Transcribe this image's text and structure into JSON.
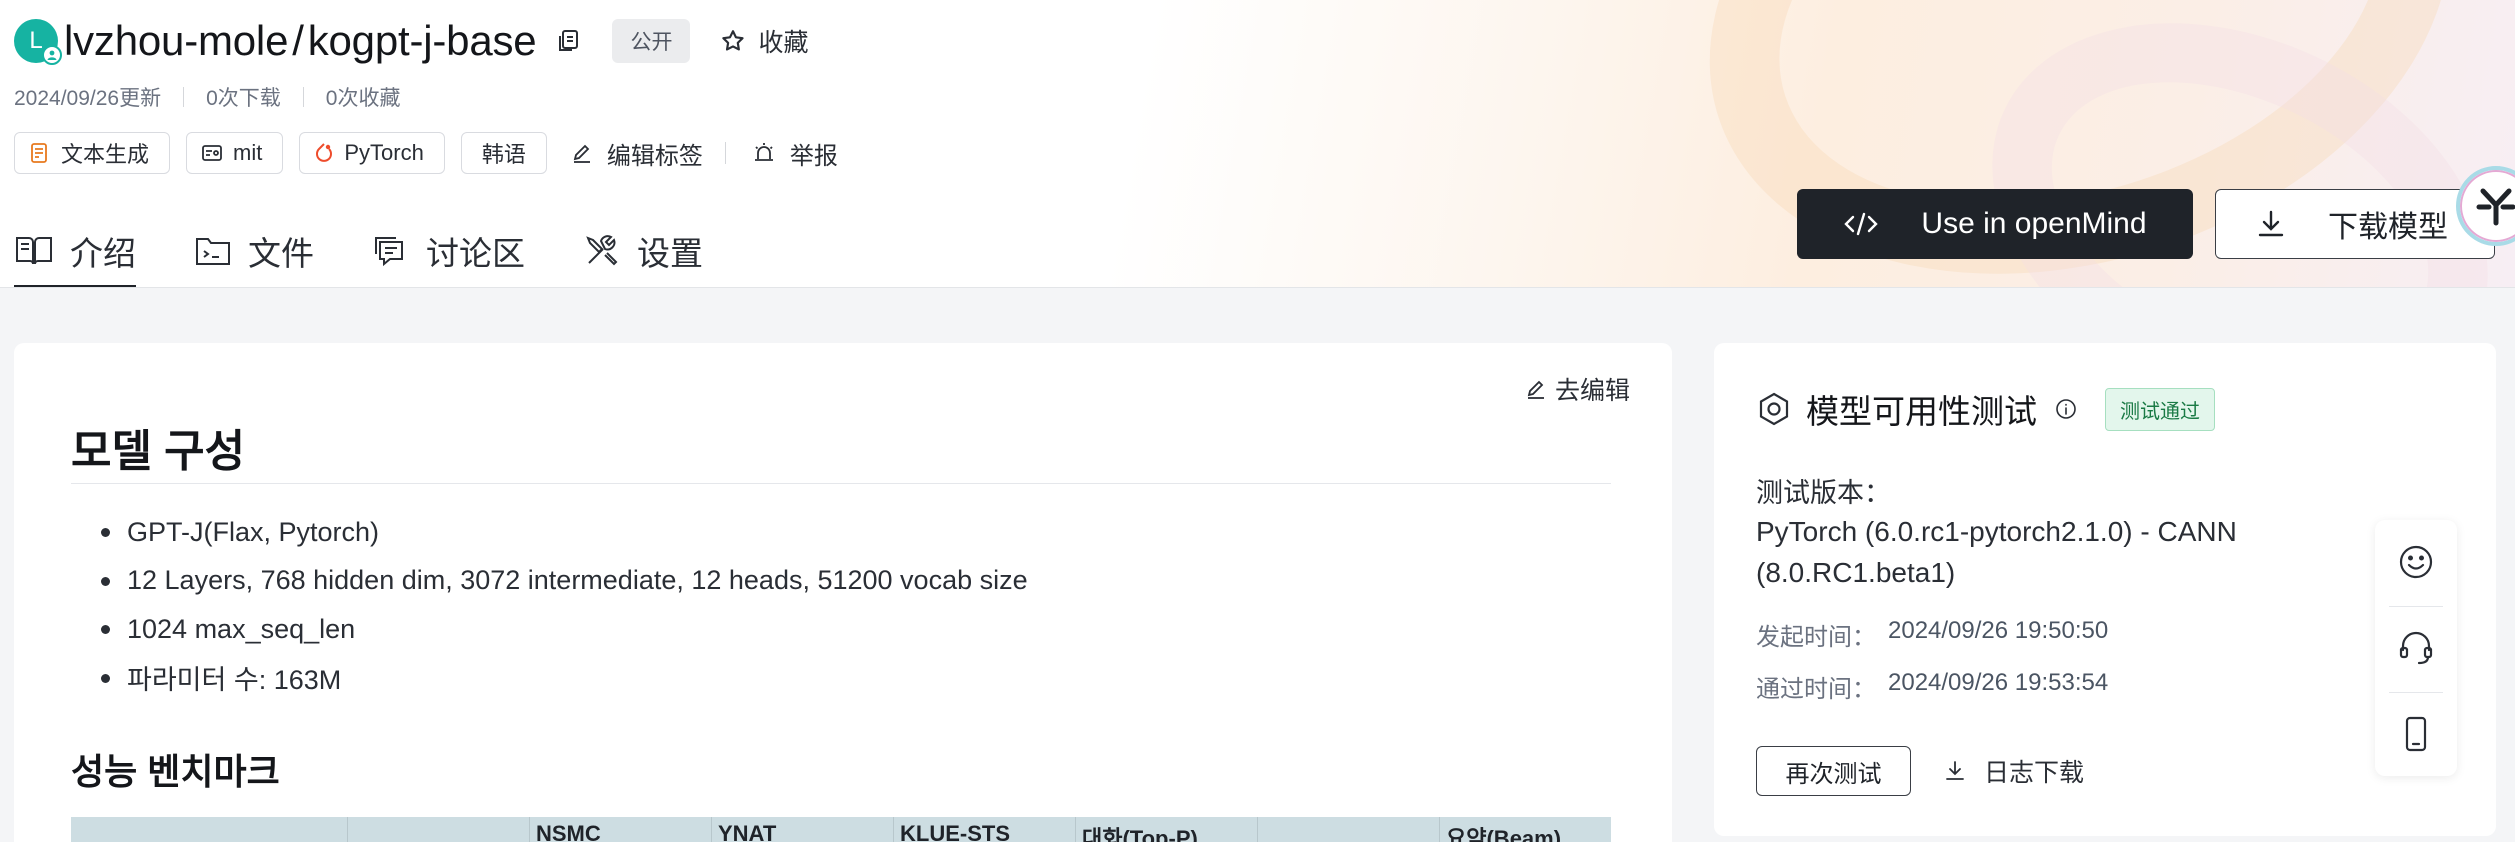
{
  "header": {
    "avatar_letter": "L",
    "owner": "lvzhou-mole",
    "separator": "/",
    "repo": "kogpt-j-base",
    "visibility": "公开",
    "favorite_label": "收藏"
  },
  "meta": {
    "updated": "2024/09/26更新",
    "downloads": "0次下载",
    "favorites": "0次收藏"
  },
  "tags": {
    "task": "文本生成",
    "license": "mit",
    "framework": "PyTorch",
    "language": "韩语",
    "edit_tags": "编辑标签",
    "report": "举报"
  },
  "tabs": [
    {
      "label": "介绍",
      "icon": "book-icon",
      "active": true
    },
    {
      "label": "文件",
      "icon": "terminal-folder-icon",
      "active": false
    },
    {
      "label": "讨论区",
      "icon": "chat-icon",
      "active": false
    },
    {
      "label": "设置",
      "icon": "tools-icon",
      "active": false
    }
  ],
  "actions": {
    "openmind": "Use in openMind",
    "download": "下载模型"
  },
  "readme": {
    "edit_label": "去编辑",
    "heading1": "모델 구성",
    "bullets": [
      "GPT-J(Flax, Pytorch)",
      "12 Layers, 768 hidden dim, 3072 intermediate, 12 heads, 51200 vocab size",
      "1024 max_seq_len",
      "파라미터 수: 163M"
    ],
    "heading2": "성능 벤치마크",
    "table_headers": [
      "",
      "",
      "NSMC",
      "YNAT",
      "KLUE-STS",
      "대화(Top-P)",
      "",
      "요약(Beam)"
    ]
  },
  "availability": {
    "title": "模型可用性测试",
    "status": "测试通过",
    "version_label": "测试版本：",
    "version": "PyTorch (6.0.rc1-pytorch2.1.0) - CANN (8.0.RC1.beta1)",
    "started_label": "发起时间：",
    "started": "2024/09/26 19:50:50",
    "passed_label": "通过时间：",
    "passed": "2024/09/26 19:53:54",
    "retest": "再次测试",
    "log_download": "日志下载"
  },
  "floating": [
    "smile-icon",
    "headset-icon",
    "mobile-icon"
  ],
  "colors": {
    "primary_dark": "#1f2329",
    "avatar": "#16b3a2",
    "pass_bg": "#e3f6ec",
    "pass_text": "#1a7a45",
    "table_header": "#cddde2"
  }
}
